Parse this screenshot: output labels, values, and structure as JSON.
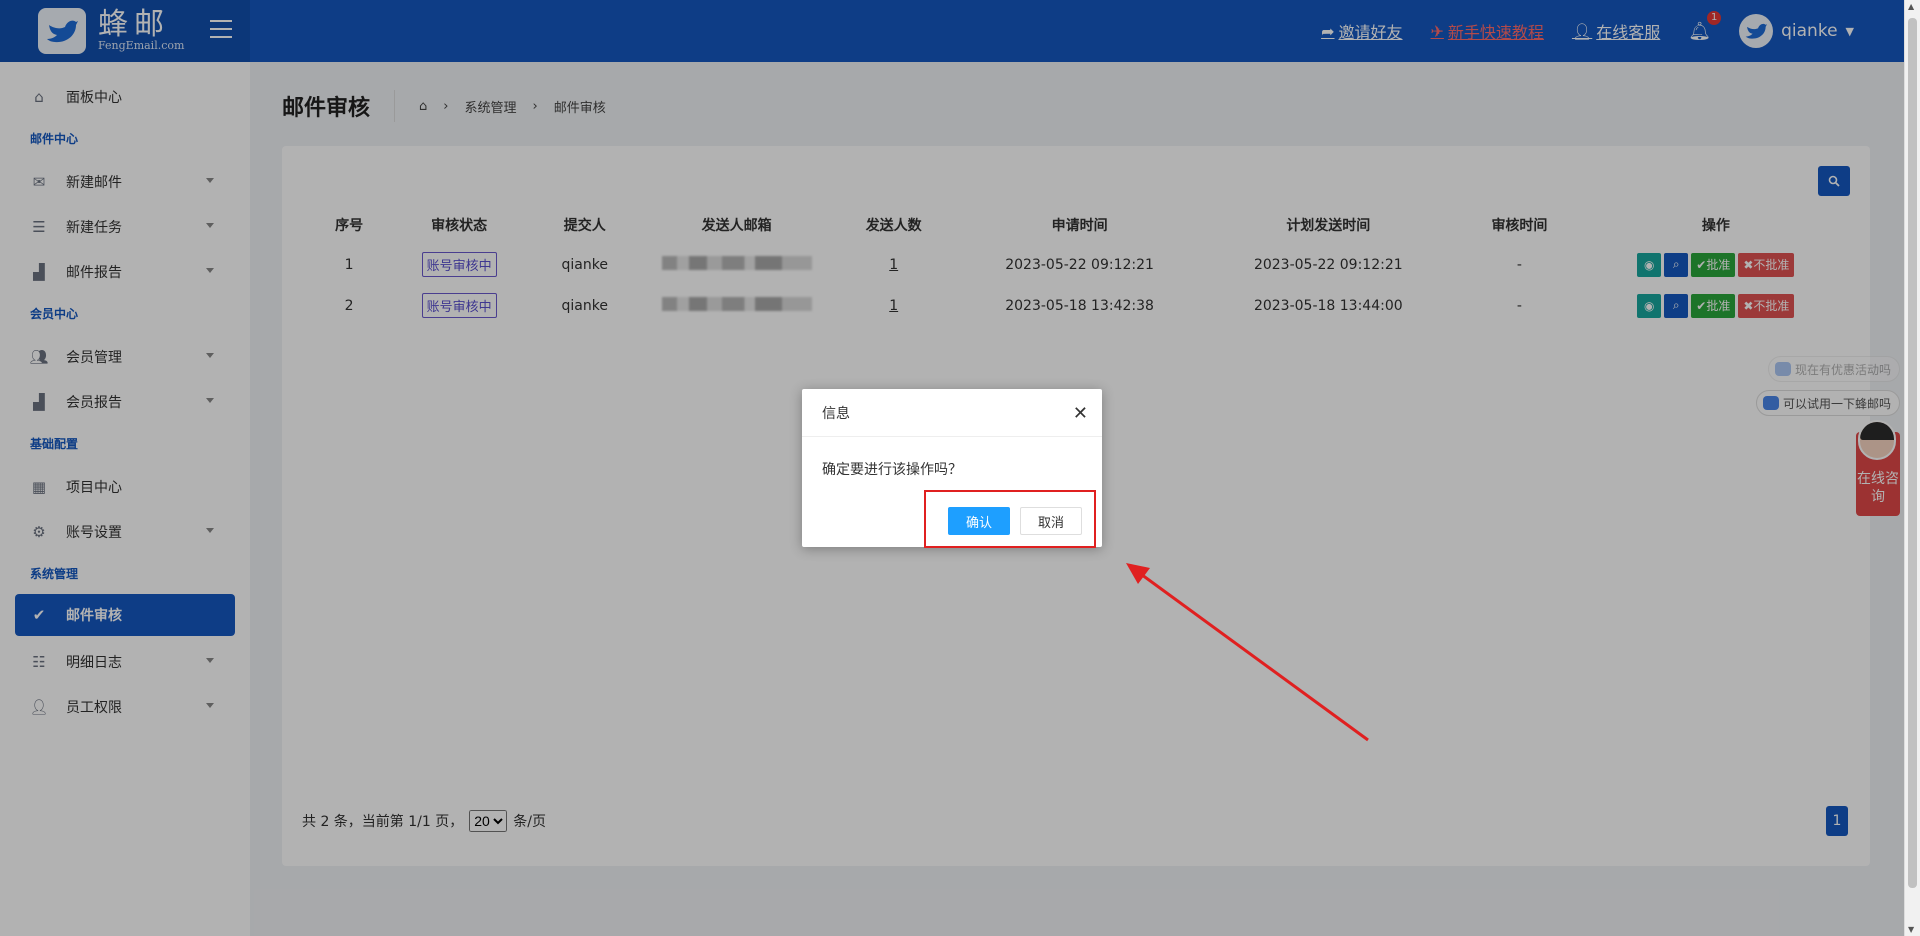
{
  "header": {
    "logo_cn": "蜂邮",
    "logo_en": "FengEmail.com",
    "links": [
      {
        "label": "邀请好友",
        "icon": "share-icon"
      },
      {
        "label": "新手快速教程",
        "icon": "rocket-icon"
      },
      {
        "label": "在线客服",
        "icon": "user-icon"
      }
    ],
    "notification_count": "1",
    "username": "qianke"
  },
  "sidebar": {
    "items": [
      {
        "type": "item",
        "label": "面板中心",
        "icon": "home-icon"
      },
      {
        "type": "section",
        "label": "邮件中心"
      },
      {
        "type": "item",
        "label": "新建邮件",
        "icon": "envelope-icon",
        "caret": true
      },
      {
        "type": "item",
        "label": "新建任务",
        "icon": "list-icon",
        "caret": true
      },
      {
        "type": "item",
        "label": "邮件报告",
        "icon": "chart-icon",
        "caret": true
      },
      {
        "type": "section",
        "label": "会员中心"
      },
      {
        "type": "item",
        "label": "会员管理",
        "icon": "users-icon",
        "caret": true
      },
      {
        "type": "item",
        "label": "会员报告",
        "icon": "chart-icon",
        "caret": true
      },
      {
        "type": "section",
        "label": "基础配置"
      },
      {
        "type": "item",
        "label": "项目中心",
        "icon": "cubes-icon"
      },
      {
        "type": "item",
        "label": "账号设置",
        "icon": "gears-icon",
        "caret": true
      },
      {
        "type": "section",
        "label": "系统管理"
      },
      {
        "type": "item",
        "label": "邮件审核",
        "icon": "check-icon",
        "active": true
      },
      {
        "type": "item",
        "label": "明细日志",
        "icon": "list-icon",
        "caret": true
      },
      {
        "type": "item",
        "label": "员工权限",
        "icon": "user-lock-icon",
        "caret": true
      }
    ]
  },
  "page": {
    "title": "邮件审核",
    "breadcrumb": [
      "系统管理",
      "邮件审核"
    ]
  },
  "table": {
    "headers": [
      "序号",
      "审核状态",
      "提交人",
      "发送人邮箱",
      "发送人数",
      "申请时间",
      "计划发送时间",
      "审核时间",
      "操作"
    ],
    "rows": [
      {
        "index": "1",
        "status": "账号审核中",
        "submitter": "qianke",
        "count": "1",
        "apply_time": "2023-05-22 09:12:21",
        "plan_time": "2023-05-22 09:12:21",
        "review_time": "-"
      },
      {
        "index": "2",
        "status": "账号审核中",
        "submitter": "qianke",
        "count": "1",
        "apply_time": "2023-05-18 13:42:38",
        "plan_time": "2023-05-18 13:44:00",
        "review_time": "-"
      }
    ],
    "approve_label": "✔批准",
    "reject_label": "✖不批准"
  },
  "pager": {
    "prefix": "共 2 条，当前第 1/1 页，",
    "page_size": "20",
    "suffix": "条/页",
    "current_page": "1"
  },
  "dialog": {
    "title": "信息",
    "message": "确定要进行该操作吗？",
    "ok_label": "确认",
    "cancel_label": "取消"
  },
  "chat": {
    "bubble1": "现在有优惠活动吗",
    "bubble2": "可以试用一下蜂邮吗",
    "consult_label": "在线咨询"
  }
}
